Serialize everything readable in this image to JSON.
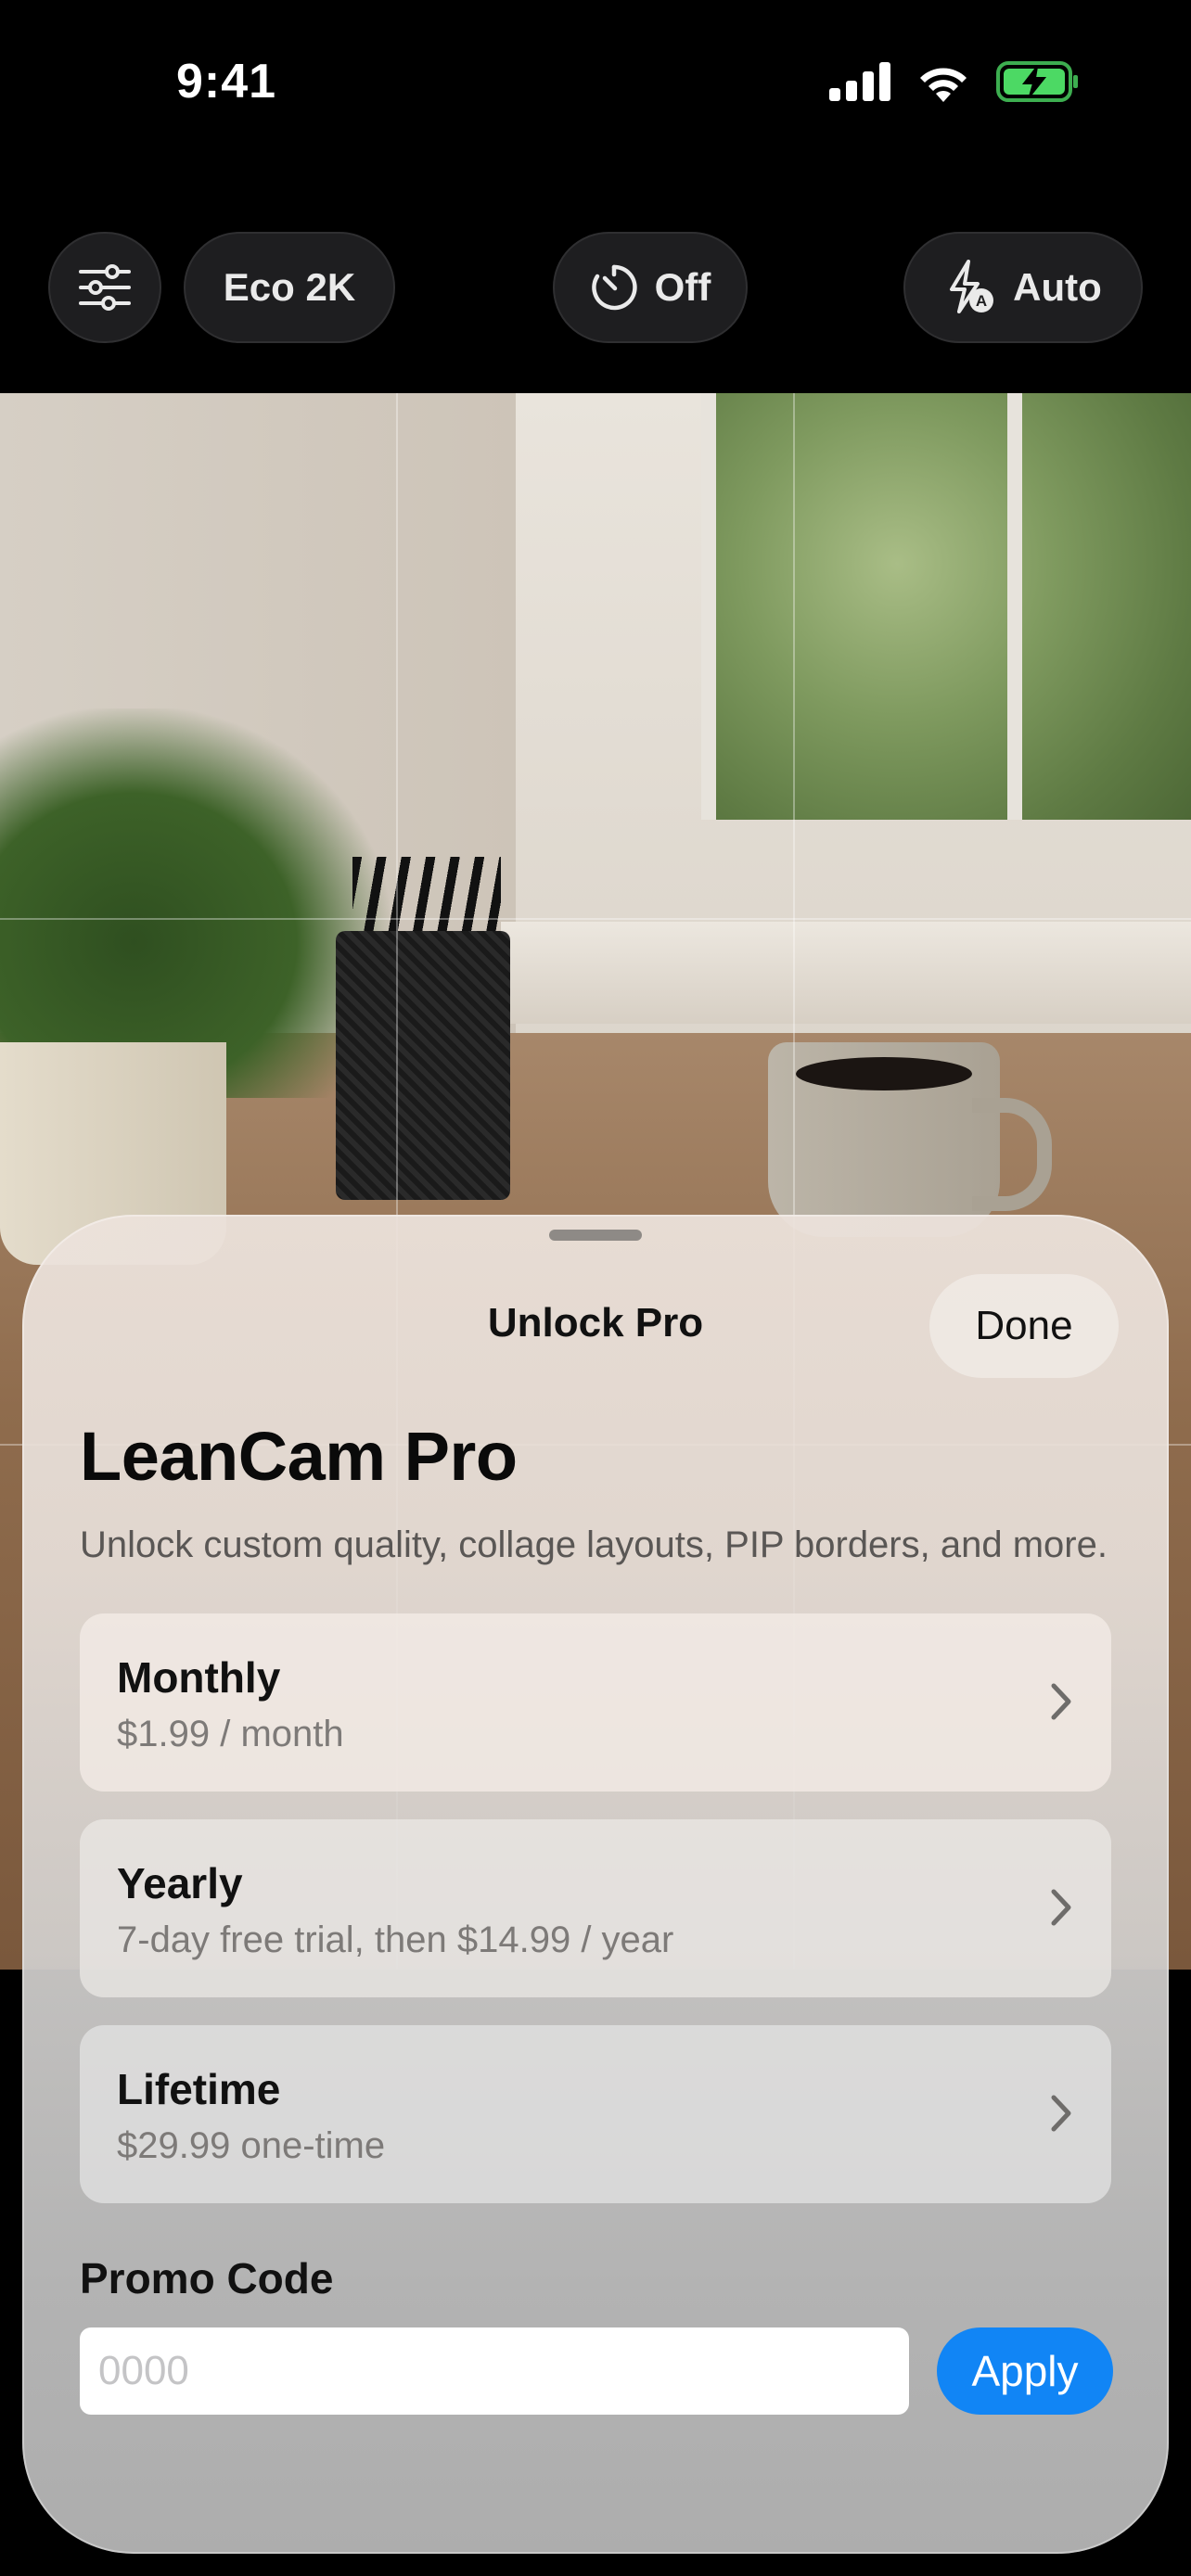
{
  "status_bar": {
    "time": "9:41",
    "icons": [
      "cellular-signal-icon",
      "wifi-icon",
      "battery-charging-icon"
    ]
  },
  "camera_controls": {
    "settings_icon": "sliders-icon",
    "quality_label": "Eco 2K",
    "timer_icon": "timer-icon",
    "timer_label": "Off",
    "flash_icon": "flash-auto-icon",
    "flash_label": "Auto"
  },
  "sheet": {
    "title": "Unlock Pro",
    "done_label": "Done",
    "pro_title": "LeanCam Pro",
    "pro_subtitle": "Unlock custom quality, collage layouts, PIP borders, and more.",
    "plans": [
      {
        "name": "Monthly",
        "price": "$1.99 / month"
      },
      {
        "name": "Yearly",
        "price": "7-day free trial, then $14.99 / year"
      },
      {
        "name": "Lifetime",
        "price": "$29.99 one-time"
      }
    ],
    "promo": {
      "label": "Promo Code",
      "placeholder": "0000",
      "value": "",
      "apply_label": "Apply"
    }
  },
  "colors": {
    "accent": "#1185f5",
    "battery_charging": "#4cd964",
    "sheet_text": "#111111",
    "secondary_text": "#7d7a78"
  }
}
